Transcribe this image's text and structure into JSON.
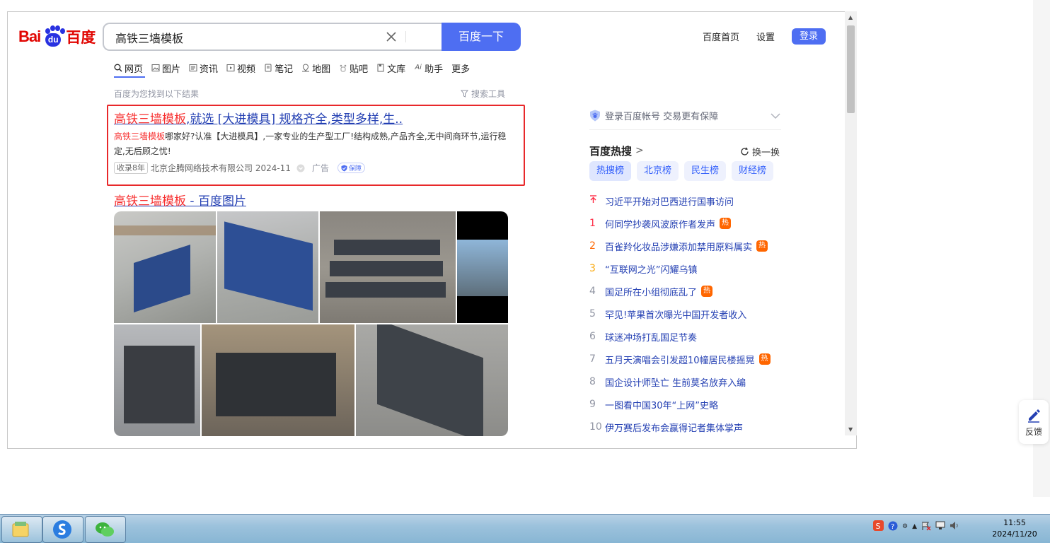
{
  "header": {
    "logo_text_left": "Bai",
    "logo_text_mid": "du",
    "logo_text_right": "百度",
    "search_value": "高铁三墙模板",
    "search_button": "百度一下",
    "links": [
      "百度首页",
      "设置"
    ],
    "login": "登录"
  },
  "tabs": [
    {
      "label": "网页",
      "icon": "search-icon"
    },
    {
      "label": "图片",
      "icon": "image-icon"
    },
    {
      "label": "资讯",
      "icon": "news-icon"
    },
    {
      "label": "视频",
      "icon": "video-icon"
    },
    {
      "label": "笔记",
      "icon": "note-icon"
    },
    {
      "label": "地图",
      "icon": "map-icon"
    },
    {
      "label": "贴吧",
      "icon": "tieba-icon"
    },
    {
      "label": "文库",
      "icon": "doc-icon"
    },
    {
      "label": "助手",
      "icon": "ai-icon"
    },
    {
      "label": "更多",
      "icon": ""
    }
  ],
  "results_meta": {
    "count_text": "百度为您找到以下结果",
    "tools": "搜索工具"
  },
  "ad": {
    "title_highlight": "高铁三墙模板",
    "title_rest": ",就选 [大进模具] 规格齐全,类型多样,生..",
    "desc_highlight": "高铁三墙模板",
    "desc_rest": "哪家好?认准【大进模具】,一家专业的生产型工厂!结构成熟,产品齐全,无中间商环节,运行稳定,无后顾之忧!",
    "years": "收录8年",
    "company": "北京企腾网络技术有限公司 2024-11",
    "ad_label": "广告",
    "guarantee": "保障"
  },
  "image_result": {
    "title_highlight": "高铁三墙模板",
    "title_rest": " - 百度图片"
  },
  "sidebar": {
    "login_tip": "登录百度帐号 交易更有保障",
    "hot_title": "百度热搜",
    "refresh": "换一换",
    "hot_tabs": [
      "热搜榜",
      "北京榜",
      "民生榜",
      "财经榜"
    ],
    "hot_items": [
      {
        "rank": "",
        "text": "习近平开始对巴西进行国事访问",
        "badge": ""
      },
      {
        "rank": "1",
        "text": "何同学抄袭风波原作者发声",
        "badge": "热"
      },
      {
        "rank": "2",
        "text": "百雀羚化妆品涉嫌添加禁用原料属实",
        "badge": "热"
      },
      {
        "rank": "3",
        "text": "“互联网之光”闪耀乌镇",
        "badge": ""
      },
      {
        "rank": "4",
        "text": "国足所在小组彻底乱了",
        "badge": "热"
      },
      {
        "rank": "5",
        "text": "罕见!苹果首次曝光中国开发者收入",
        "badge": ""
      },
      {
        "rank": "6",
        "text": "球迷冲场打乱国足节奏",
        "badge": ""
      },
      {
        "rank": "7",
        "text": "五月天演唱会引发超10幢居民楼摇晃",
        "badge": "热"
      },
      {
        "rank": "8",
        "text": "国企设计师坠亡 生前莫名放弃入编",
        "badge": ""
      },
      {
        "rank": "9",
        "text": "一图看中国30年“上网”史略",
        "badge": ""
      },
      {
        "rank": "10",
        "text": "伊万赛后发布会赢得记者集体掌声",
        "badge": ""
      }
    ]
  },
  "feedback": "反馈",
  "taskbar": {
    "time": "11:55",
    "date": "2024/11/20"
  }
}
